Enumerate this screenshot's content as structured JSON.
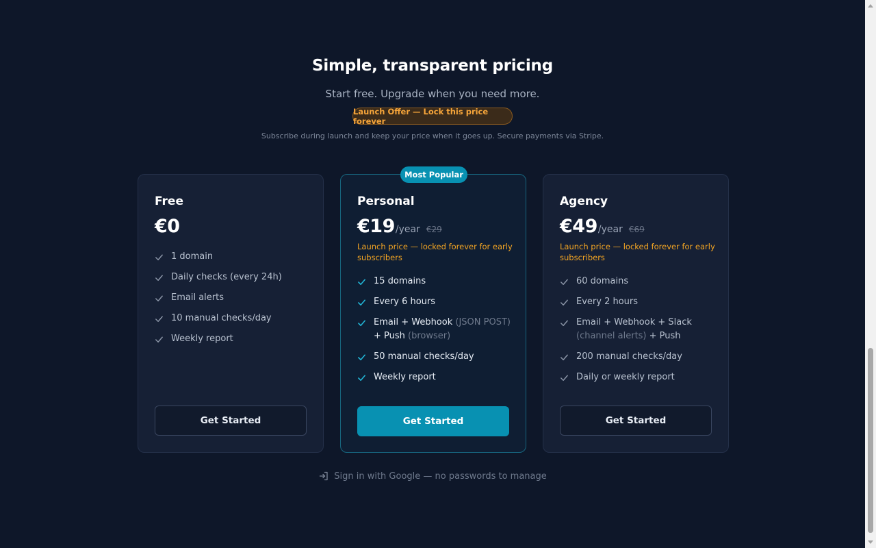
{
  "header": {
    "title": "Simple, transparent pricing",
    "subtitle": "Start free. Upgrade when you need more.",
    "launch_badge": "Launch Offer — Lock this price forever",
    "launch_note": "Subscribe during launch and keep your price when it goes up. Secure payments via Stripe."
  },
  "plans": [
    {
      "name": "Free",
      "price": "€0",
      "features": [
        {
          "text": "1 domain"
        },
        {
          "text": "Daily checks (every 24h)"
        },
        {
          "text": "Email alerts"
        },
        {
          "text": "10 manual checks/day"
        },
        {
          "text": "Weekly report"
        }
      ],
      "cta": "Get Started"
    },
    {
      "name": "Personal",
      "badge": "Most Popular",
      "price": "€19",
      "period": "/year",
      "old_price": "€29",
      "launch_note": "Launch price — locked forever for early subscribers",
      "features": [
        {
          "text": "15 domains"
        },
        {
          "text": "Every 6 hours"
        },
        {
          "text": "Email + Webhook",
          "muted_1": "(JSON POST)",
          "text_2": "+ Push",
          "muted_2": "(browser)"
        },
        {
          "text": "50 manual checks/day"
        },
        {
          "text": "Weekly report"
        }
      ],
      "cta": "Get Started"
    },
    {
      "name": "Agency",
      "price": "€49",
      "period": "/year",
      "old_price": "€69",
      "launch_note": "Launch price — locked forever for early subscribers",
      "features": [
        {
          "text": "60 domains"
        },
        {
          "text": "Every 2 hours"
        },
        {
          "text": "Email + Webhook + Slack",
          "muted_1": "(channel alerts)",
          "text_2": "+ Push"
        },
        {
          "text": "200 manual checks/day"
        },
        {
          "text": "Daily or weekly report"
        }
      ],
      "cta": "Get Started"
    }
  ],
  "footer": {
    "signin_text": "Sign in with Google — no passwords to manage",
    "signin_icon": "sign-in-icon"
  },
  "colors": {
    "background": "#0e1729",
    "accent": "#0891b2",
    "launch_orange": "#f5a623",
    "check_free": "#8b95a7",
    "check_popular": "#22b8d8"
  }
}
